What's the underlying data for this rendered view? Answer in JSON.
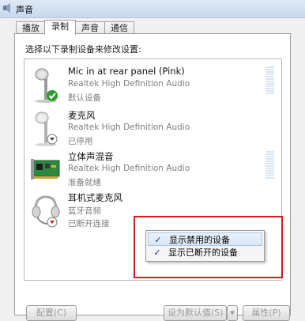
{
  "window": {
    "title": "声音"
  },
  "tabs": [
    {
      "label": "播放",
      "active": false
    },
    {
      "label": "录制",
      "active": true
    },
    {
      "label": "声音",
      "active": false
    },
    {
      "label": "通信",
      "active": false
    }
  ],
  "panel": {
    "instructions": "选择以下录制设备来修改设置:"
  },
  "devices": [
    {
      "name": "Mic in at rear panel (Pink)",
      "driver": "Realtek High Definition Audio",
      "status": "默认设备",
      "icon": "microphone-icon",
      "badge": "default-check-icon"
    },
    {
      "name": "麦克风",
      "driver": "Realtek High Definition Audio",
      "status": "已停用",
      "icon": "microphone-icon",
      "badge": "disabled-arrow-icon"
    },
    {
      "name": "立体声混音",
      "driver": "Realtek High Definition Audio",
      "status": "准备就绪",
      "icon": "sound-card-icon",
      "badge": ""
    },
    {
      "name": "耳机式麦克风",
      "driver": "蓝牙音频",
      "status": "已断开连接",
      "icon": "headset-icon",
      "badge": "disconnected-arrow-icon"
    }
  ],
  "context_menu": {
    "items": [
      {
        "label": "显示禁用的设备",
        "checked": true
      },
      {
        "label": "显示已断开的设备",
        "checked": true
      }
    ]
  },
  "buttons": {
    "configure": "配置(C)",
    "set_default": "设为默认值(S)",
    "properties": "属性(P)"
  },
  "colors": {
    "annotation": "#d9191c",
    "accent": "#3a6fb7"
  }
}
